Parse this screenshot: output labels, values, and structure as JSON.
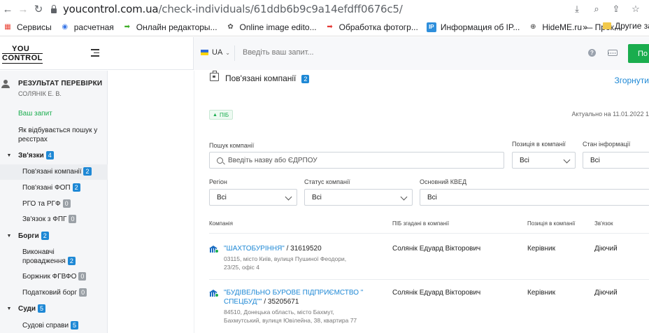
{
  "browser": {
    "url_domain": "youcontrol.com.ua",
    "url_path": "/check-individuals/61ddb6b9c9a14efdff0676c5/",
    "bookmarks": [
      {
        "label": "Сервисы",
        "icon": "apps-grid-icon",
        "color": "#ea4335"
      },
      {
        "label": "расчетная",
        "icon": "globe-icon",
        "color": "#3b78e7"
      },
      {
        "label": "Онлайн редакторы...",
        "icon": "green-arrow-icon",
        "color": "#3fae29"
      },
      {
        "label": "Online image edito...",
        "icon": "aperture-icon",
        "color": "#555555"
      },
      {
        "label": "Обработка фотогр...",
        "icon": "red-arrow-icon",
        "color": "#e53935"
      },
      {
        "label": "Информация об IP...",
        "icon": "ip-icon",
        "color": "#2f8fdb"
      },
      {
        "label": "HideME.ru — Прок...",
        "icon": "hideme-icon",
        "color": "#333333"
      }
    ],
    "more": "»",
    "other_bookmarks": "Другие за"
  },
  "header": {
    "logo_top": "YOU",
    "logo_bottom": "CONTROL",
    "lang": "UA",
    "search_placeholder": "Введіть ваш запит...",
    "help": "?",
    "go_button": "По"
  },
  "sidebar": {
    "result_title": "РЕЗУЛЬТАТ ПЕРЕВІРКИ",
    "result_name": "СОЛЯНІК Е. В.",
    "your_query": "Ваш запит",
    "how_search": "Як відбувається пошук у реєстрах",
    "groups": [
      {
        "label": "Зв'язки",
        "count": "4"
      },
      {
        "label": "Борги",
        "count": "2"
      },
      {
        "label": "Суди",
        "count": "5"
      }
    ],
    "links_items": [
      {
        "label": "Пов'язані компанії",
        "count": "2"
      },
      {
        "label": "Пов'язані ФОП",
        "count": "2"
      },
      {
        "label": "РГО та РГФ",
        "count": "0"
      },
      {
        "label": "Зв'язок з ФПГ",
        "count": "0"
      }
    ],
    "debt_items": [
      {
        "label": "Виконавчі провадження",
        "count": "2"
      },
      {
        "label": "Боржник ФГВФО",
        "count": "0"
      },
      {
        "label": "Податковий борг",
        "count": "0"
      }
    ],
    "court_items": [
      {
        "label": "Судові справи",
        "count": "5"
      }
    ]
  },
  "panel": {
    "title": "Пов'язані компанії",
    "count": "2",
    "collapse": "Згорнути",
    "tag": "ПІБ",
    "actual_date": "Актуально на 11.01.2022 1",
    "filters": {
      "company_search_label": "Пошук компанії",
      "company_search_placeholder": "Введіть назву або ЄДРПОУ",
      "position_label": "Позиція в компанії",
      "position_value": "Всі",
      "info_state_label": "Стан інформації",
      "info_state_value": "Всі",
      "region_label": "Регіон",
      "region_value": "Всі",
      "status_label": "Статус компанії",
      "status_value": "Всі",
      "kved_label": "Основний КВЕД",
      "kved_value": "Всі"
    },
    "table": {
      "headers": [
        "Компанія",
        "ПІБ згадані в компанії",
        "Позиція в компанії",
        "Зв'язок"
      ],
      "rows": [
        {
          "name": "\"ШАХТОБУРІННЯ\"",
          "code": " / 31619520",
          "address": "03115, місто Київ, вулиця Пушиної Феодори, 23/25, офіс 4",
          "person": "Солянік Едуард Вікторович",
          "position": "Керівник",
          "link": "Діючий"
        },
        {
          "name": "\"БУДІВЕЛЬНО БУРОВЕ ПІДПРИЄМСТВО \" СПЕЦБУД\"\"",
          "code": " / 35205671",
          "address": "84510, Донецька область, місто Бахмут, Бахмутський, вулиця Ювілейна, 38, квартира 77",
          "person": "Солянік Едуард Вікторович",
          "position": "Керівник",
          "link": "Діючий"
        }
      ]
    }
  },
  "colors": {
    "accent_green": "#1aad4e",
    "link_blue": "#1e88d5"
  }
}
